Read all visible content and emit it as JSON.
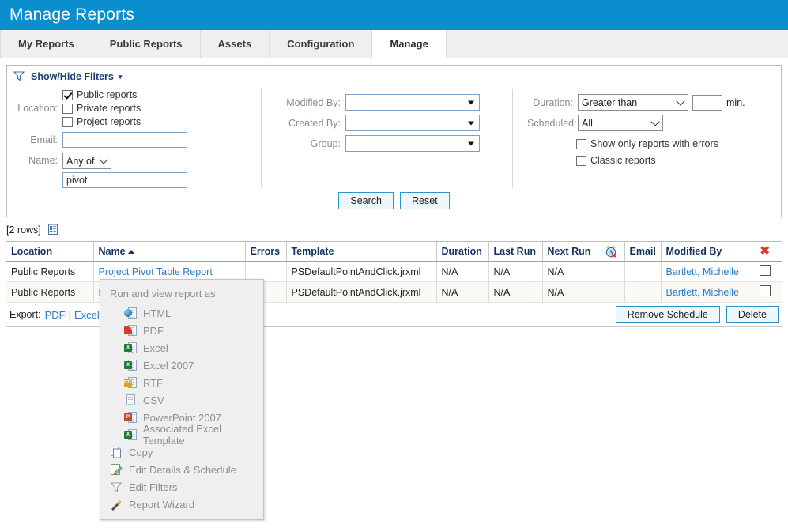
{
  "header": {
    "title": "Manage Reports",
    "accent_color": "#0b8ecd"
  },
  "tabs": [
    {
      "label": "My Reports",
      "active": false
    },
    {
      "label": "Public Reports",
      "active": false
    },
    {
      "label": "Assets",
      "active": false
    },
    {
      "label": "Configuration",
      "active": false
    },
    {
      "label": "Manage",
      "active": true
    }
  ],
  "filters": {
    "toggle_label": "Show/Hide Filters",
    "toggle_caret": "▾",
    "left": {
      "location_label": "Location:",
      "location_options": [
        {
          "label": "Public reports",
          "checked": true
        },
        {
          "label": "Private reports",
          "checked": false
        },
        {
          "label": "Project reports",
          "checked": false
        }
      ],
      "email_label": "Email:",
      "email_value": "",
      "name_label": "Name:",
      "name_match_value": "Any of",
      "name_value": "pivot"
    },
    "middle": [
      {
        "label": "Modified By:",
        "value": ""
      },
      {
        "label": "Created By:",
        "value": ""
      },
      {
        "label": "Group:",
        "value": ""
      }
    ],
    "right": {
      "duration_label": "Duration:",
      "duration_operator": "Greater than",
      "duration_value": "",
      "duration_unit": "min.",
      "scheduled_label": "Scheduled:",
      "scheduled_value": "All",
      "errors_checkbox_label": "Show only reports with errors",
      "errors_checked": false,
      "classic_checkbox_label": "Classic reports",
      "classic_checked": false
    },
    "search_button": "Search",
    "reset_button": "Reset"
  },
  "results": {
    "row_count_label": "[2 rows]",
    "columns": [
      "Location",
      "Name",
      "Errors",
      "Template",
      "Duration",
      "Last Run",
      "Next Run",
      "",
      "Email",
      "Modified By",
      ""
    ],
    "sorted_column": "Name",
    "sort_direction": "asc",
    "schedule_col_icon": "alarm-clock-icon",
    "delete_col_icon": "red-x-icon",
    "rows": [
      {
        "location": "Public Reports",
        "name": "Project Pivot Table Report",
        "errors": "",
        "template": "PSDefaultPointAndClick.jrxml",
        "duration": "N/A",
        "last_run": "N/A",
        "next_run": "N/A",
        "schedule": "",
        "email": "",
        "modified_by": "Bartlett, Michelle",
        "selected": false
      },
      {
        "location": "Public Reports",
        "name": "R",
        "errors": "",
        "template": "PSDefaultPointAndClick.jrxml",
        "duration": "N/A",
        "last_run": "N/A",
        "next_run": "N/A",
        "schedule": "",
        "email": "",
        "modified_by": "Bartlett, Michelle",
        "selected": false
      }
    ]
  },
  "export_bar": {
    "label": "Export:",
    "pdf": "PDF",
    "separator": "|",
    "excel": "Excel",
    "remove_schedule_button": "Remove Schedule",
    "delete_button": "Delete"
  },
  "context_menu": {
    "title": "Run and view report as:",
    "formats": [
      {
        "label": "HTML",
        "icon": "html-globe-icon"
      },
      {
        "label": "PDF",
        "icon": "pdf-icon"
      },
      {
        "label": "Excel",
        "icon": "excel-icon"
      },
      {
        "label": "Excel 2007",
        "icon": "excel-2007-icon"
      },
      {
        "label": "RTF",
        "icon": "rtf-icon"
      },
      {
        "label": "CSV",
        "icon": "csv-icon"
      },
      {
        "label": "PowerPoint 2007",
        "icon": "powerpoint-icon"
      },
      {
        "label": "Associated Excel Template",
        "icon": "excel-template-icon"
      }
    ],
    "actions": [
      {
        "label": "Copy",
        "icon": "copy-icon"
      },
      {
        "label": "Edit Details & Schedule",
        "icon": "edit-details-icon"
      },
      {
        "label": "Edit Filters",
        "icon": "filter-funnel-icon"
      },
      {
        "label": "Report Wizard",
        "icon": "wand-icon"
      }
    ]
  }
}
